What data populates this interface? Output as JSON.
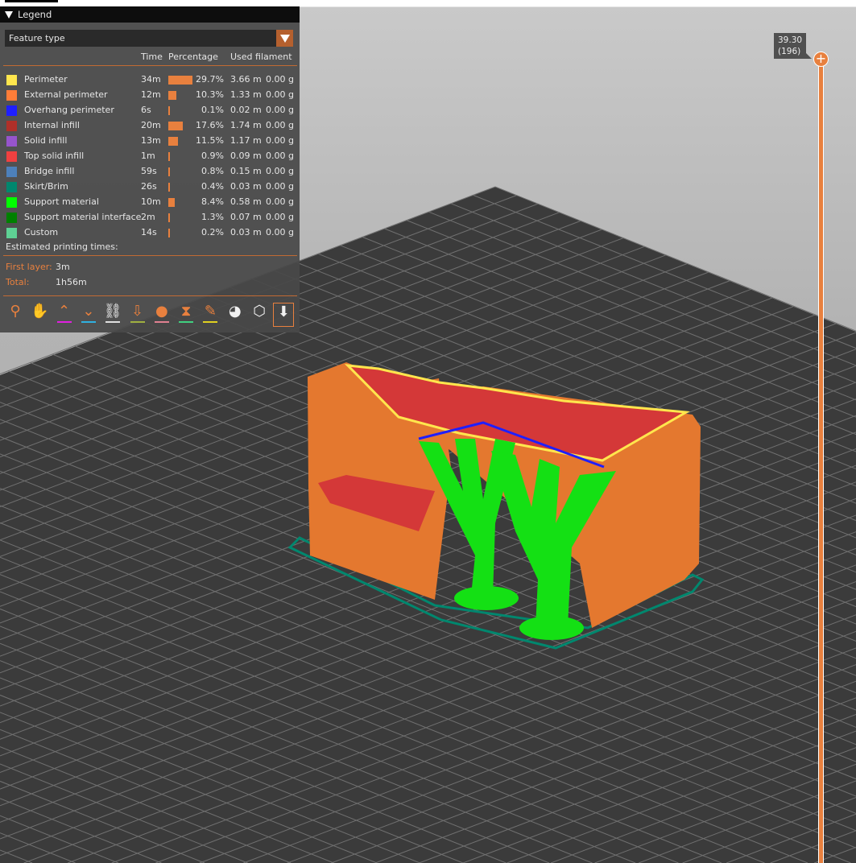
{
  "legend": {
    "title": "Legend",
    "view_type": "Feature type",
    "columns": {
      "time": "Time",
      "percentage": "Percentage",
      "used_filament": "Used filament"
    },
    "rows": [
      {
        "label": "Perimeter",
        "color": "#FFE64D",
        "time": "34m",
        "percent": 29.7,
        "percent_text": "29.7%",
        "length": "3.66 m",
        "weight": "0.00 g"
      },
      {
        "label": "External perimeter",
        "color": "#FF7D38",
        "time": "12m",
        "percent": 10.3,
        "percent_text": "10.3%",
        "length": "1.33 m",
        "weight": "0.00 g"
      },
      {
        "label": "Overhang perimeter",
        "color": "#1F1FFF",
        "time": "6s",
        "percent": 0.1,
        "percent_text": "0.1%",
        "length": "0.02 m",
        "weight": "0.00 g"
      },
      {
        "label": "Internal infill",
        "color": "#B03029",
        "time": "20m",
        "percent": 17.6,
        "percent_text": "17.6%",
        "length": "1.74 m",
        "weight": "0.00 g"
      },
      {
        "label": "Solid infill",
        "color": "#9654CC",
        "time": "13m",
        "percent": 11.5,
        "percent_text": "11.5%",
        "length": "1.17 m",
        "weight": "0.00 g"
      },
      {
        "label": "Top solid infill",
        "color": "#F04040",
        "time": "1m",
        "percent": 0.9,
        "percent_text": "0.9%",
        "length": "0.09 m",
        "weight": "0.00 g"
      },
      {
        "label": "Bridge infill",
        "color": "#4D80BA",
        "time": "59s",
        "percent": 0.8,
        "percent_text": "0.8%",
        "length": "0.15 m",
        "weight": "0.00 g"
      },
      {
        "label": "Skirt/Brim",
        "color": "#00876E",
        "time": "26s",
        "percent": 0.4,
        "percent_text": "0.4%",
        "length": "0.03 m",
        "weight": "0.00 g"
      },
      {
        "label": "Support material",
        "color": "#00FF00",
        "time": "10m",
        "percent": 8.4,
        "percent_text": "8.4%",
        "length": "0.58 m",
        "weight": "0.00 g"
      },
      {
        "label": "Support material interface",
        "color": "#008000",
        "time": "2m",
        "percent": 1.3,
        "percent_text": "1.3%",
        "length": "0.07 m",
        "weight": "0.00 g"
      },
      {
        "label": "Custom",
        "color": "#5ED194",
        "time": "14s",
        "percent": 0.2,
        "percent_text": "0.2%",
        "length": "0.03 m",
        "weight": "0.00 g"
      }
    ],
    "estimated_title": "Estimated printing times:",
    "first_layer_label": "First layer:",
    "first_layer_value": "3m",
    "total_label": "Total:",
    "total_value": "1h56m",
    "toolbar_icons": [
      {
        "name": "travel-icon",
        "glyph": "⚲",
        "underline": ""
      },
      {
        "name": "wipe-icon",
        "glyph": "✋",
        "underline": ""
      },
      {
        "name": "retractions-icon",
        "glyph": "⌃",
        "underline": "#e020e0"
      },
      {
        "name": "deretractions-icon",
        "glyph": "⌄",
        "underline": "#30b0e0"
      },
      {
        "name": "seams-icon",
        "glyph": "⛓",
        "underline": "#e0e0e0"
      },
      {
        "name": "tool-changes-icon",
        "glyph": "⇩",
        "underline": "#a0b040"
      },
      {
        "name": "color-changes-icon",
        "glyph": "●",
        "underline": "#e08090"
      },
      {
        "name": "pause-prints-icon",
        "glyph": "⧗",
        "underline": "#40d080"
      },
      {
        "name": "custom-gcodes-icon",
        "glyph": "✎",
        "underline": "#e0d020"
      },
      {
        "name": "center-of-gravity-icon",
        "glyph": "◕",
        "underline": ""
      },
      {
        "name": "shells-icon",
        "glyph": "⬡",
        "underline": ""
      },
      {
        "name": "tool-marker-icon",
        "glyph": "⬇",
        "underline": ""
      }
    ]
  },
  "layer_slider": {
    "height": "39.30",
    "layer": "(196)",
    "position": 1.0
  }
}
